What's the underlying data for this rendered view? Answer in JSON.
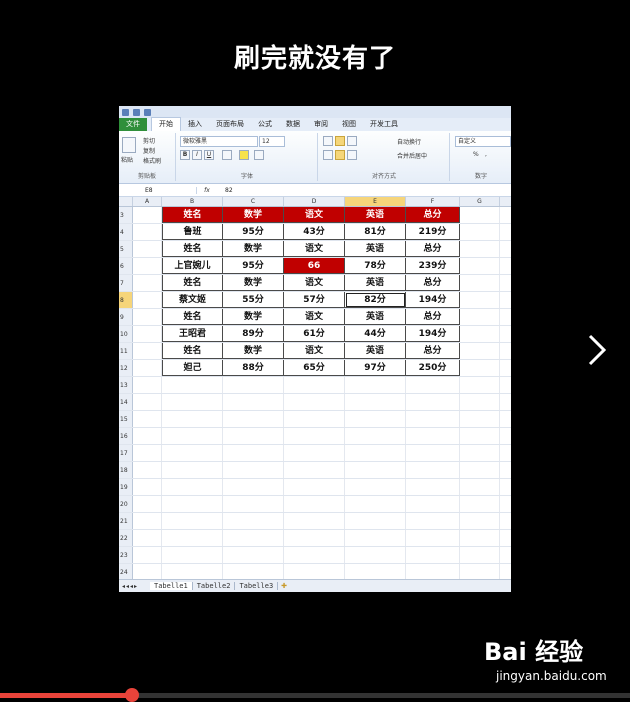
{
  "caption": "刷完就没有了",
  "excel": {
    "tabs": [
      "文件",
      "开始",
      "插入",
      "页面布局",
      "公式",
      "数据",
      "审阅",
      "视图",
      "开发工具"
    ],
    "active_tab": "开始",
    "ribbon": {
      "clipboard": {
        "paste": "粘贴",
        "cut": "剪切",
        "copy": "复制",
        "format_painter": "格式刷",
        "label": "剪贴板"
      },
      "font": {
        "font_name": "微软雅黑",
        "font_size": "12",
        "bold": "B",
        "italic": "I",
        "underline": "U",
        "label": "字体"
      },
      "alignment": {
        "wrap": "自动换行",
        "merge": "合并后居中",
        "label": "对齐方式"
      },
      "number": {
        "format": "自定义",
        "percent": "%",
        "comma": ",",
        "label": "数字"
      }
    },
    "formula_bar": {
      "name_box": "E8",
      "fx": "fx",
      "value": "82"
    },
    "columns": [
      "A",
      "B",
      "C",
      "D",
      "E",
      "F",
      "G"
    ],
    "selected_column": "E",
    "selected_row": "8",
    "table_rows": [
      {
        "row": "3",
        "cells": [
          "姓名",
          "数学",
          "语文",
          "英语",
          "总分"
        ],
        "header": true
      },
      {
        "row": "4",
        "cells": [
          "鲁班",
          "95分",
          "43分",
          "81分",
          "219分"
        ]
      },
      {
        "row": "5",
        "cells": [
          "姓名",
          "数学",
          "语文",
          "英语",
          "总分"
        ]
      },
      {
        "row": "6",
        "cells": [
          "上官婉儿",
          "95分",
          "66",
          "78分",
          "239分"
        ]
      },
      {
        "row": "7",
        "cells": [
          "姓名",
          "数学",
          "语文",
          "英语",
          "总分"
        ]
      },
      {
        "row": "8",
        "cells": [
          "蔡文姬",
          "55分",
          "57分",
          "82分",
          "194分"
        ]
      },
      {
        "row": "9",
        "cells": [
          "姓名",
          "数学",
          "语文",
          "英语",
          "总分"
        ]
      },
      {
        "row": "10",
        "cells": [
          "王昭君",
          "89分",
          "61分",
          "44分",
          "194分"
        ]
      },
      {
        "row": "11",
        "cells": [
          "姓名",
          "数学",
          "语文",
          "英语",
          "总分"
        ]
      },
      {
        "row": "12",
        "cells": [
          "妲己",
          "88分",
          "65分",
          "97分",
          "250分"
        ]
      }
    ],
    "empty_rows": [
      "13",
      "14",
      "15",
      "16",
      "17",
      "18",
      "19",
      "20",
      "21",
      "22",
      "23",
      "24"
    ],
    "sheets": [
      "Tabelle1",
      "Tabelle2",
      "Tabelle3"
    ],
    "active_sheet": "Tabelle1",
    "colors": {
      "header_fill": "#c00000",
      "highlight_fill": "#c00000",
      "selection": "#f6d57a"
    }
  },
  "watermark": {
    "brand": "Bai  经验",
    "url": "jingyan.baidu.com"
  },
  "video_progress": 0.21,
  "icons": {
    "next": "chevron-right-icon"
  }
}
